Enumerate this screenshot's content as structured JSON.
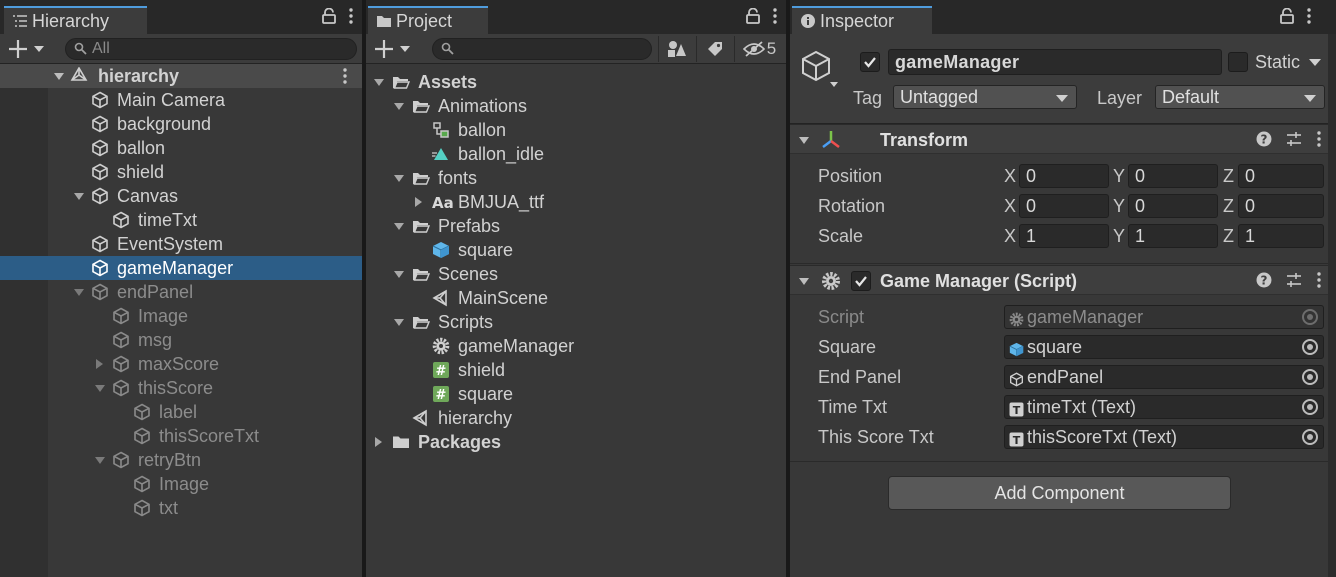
{
  "hierarchy": {
    "tab_title": "Hierarchy",
    "search_placeholder": "All",
    "scene_name": "hierarchy",
    "items": [
      {
        "label": "Main Camera",
        "depth": 1,
        "icon": "gameobject-cube-icon",
        "state": "normal",
        "arrow": "none"
      },
      {
        "label": "background",
        "depth": 1,
        "icon": "gameobject-cube-icon",
        "state": "normal",
        "arrow": "none"
      },
      {
        "label": "ballon",
        "depth": 1,
        "icon": "gameobject-cube-icon",
        "state": "normal",
        "arrow": "none"
      },
      {
        "label": "shield",
        "depth": 1,
        "icon": "gameobject-cube-icon",
        "state": "normal",
        "arrow": "none"
      },
      {
        "label": "Canvas",
        "depth": 1,
        "icon": "gameobject-cube-icon",
        "state": "normal",
        "arrow": "expanded"
      },
      {
        "label": "timeTxt",
        "depth": 2,
        "icon": "gameobject-cube-icon",
        "state": "normal",
        "arrow": "none"
      },
      {
        "label": "EventSystem",
        "depth": 1,
        "icon": "gameobject-cube-icon",
        "state": "normal",
        "arrow": "none"
      },
      {
        "label": "gameManager",
        "depth": 1,
        "icon": "gameobject-cube-icon",
        "state": "selected",
        "arrow": "none"
      },
      {
        "label": "endPanel",
        "depth": 1,
        "icon": "gameobject-cube-icon",
        "state": "disabled",
        "arrow": "expanded"
      },
      {
        "label": "Image",
        "depth": 2,
        "icon": "gameobject-cube-icon",
        "state": "disabled",
        "arrow": "none"
      },
      {
        "label": "msg",
        "depth": 2,
        "icon": "gameobject-cube-icon",
        "state": "disabled",
        "arrow": "none"
      },
      {
        "label": "maxScore",
        "depth": 2,
        "icon": "gameobject-cube-icon",
        "state": "disabled",
        "arrow": "collapsed"
      },
      {
        "label": "thisScore",
        "depth": 2,
        "icon": "gameobject-cube-icon",
        "state": "disabled",
        "arrow": "expanded"
      },
      {
        "label": "label",
        "depth": 3,
        "icon": "gameobject-cube-icon",
        "state": "disabled",
        "arrow": "none"
      },
      {
        "label": "thisScoreTxt",
        "depth": 3,
        "icon": "gameobject-cube-icon",
        "state": "disabled",
        "arrow": "none"
      },
      {
        "label": "retryBtn",
        "depth": 2,
        "icon": "gameobject-cube-icon",
        "state": "disabled",
        "arrow": "expanded"
      },
      {
        "label": "Image",
        "depth": 3,
        "icon": "gameobject-cube-icon",
        "state": "disabled",
        "arrow": "none"
      },
      {
        "label": "txt",
        "depth": 3,
        "icon": "gameobject-cube-icon",
        "state": "disabled",
        "arrow": "none"
      }
    ]
  },
  "project": {
    "tab_title": "Project",
    "search_value": "",
    "hidden_count": "5",
    "items": [
      {
        "label": "Assets",
        "depth": 0,
        "icon": "folder-open-icon",
        "arrow": "expanded",
        "bold": true
      },
      {
        "label": "Animations",
        "depth": 1,
        "icon": "folder-open-icon",
        "arrow": "expanded",
        "bold": false
      },
      {
        "label": "ballon",
        "depth": 2,
        "icon": "animator-controller-icon",
        "arrow": "none",
        "bold": false
      },
      {
        "label": "ballon_idle",
        "depth": 2,
        "icon": "animation-clip-icon",
        "arrow": "none",
        "bold": false
      },
      {
        "label": "fonts",
        "depth": 1,
        "icon": "folder-open-icon",
        "arrow": "expanded",
        "bold": false
      },
      {
        "label": "BMJUA_ttf",
        "depth": 2,
        "icon": "font-icon",
        "arrow": "collapsed",
        "bold": false
      },
      {
        "label": "Prefabs",
        "depth": 1,
        "icon": "folder-open-icon",
        "arrow": "expanded",
        "bold": false
      },
      {
        "label": "square",
        "depth": 2,
        "icon": "prefab-icon",
        "arrow": "none",
        "bold": false
      },
      {
        "label": "Scenes",
        "depth": 1,
        "icon": "folder-open-icon",
        "arrow": "expanded",
        "bold": false
      },
      {
        "label": "MainScene",
        "depth": 2,
        "icon": "unity-scene-icon",
        "arrow": "none",
        "bold": false
      },
      {
        "label": "Scripts",
        "depth": 1,
        "icon": "folder-open-icon",
        "arrow": "expanded",
        "bold": false
      },
      {
        "label": "gameManager",
        "depth": 2,
        "icon": "script-gear-icon",
        "arrow": "none",
        "bold": false
      },
      {
        "label": "shield",
        "depth": 2,
        "icon": "csharp-script-icon",
        "arrow": "none",
        "bold": false
      },
      {
        "label": "square",
        "depth": 2,
        "icon": "csharp-script-icon",
        "arrow": "none",
        "bold": false
      },
      {
        "label": "hierarchy",
        "depth": 1,
        "icon": "unity-scene-icon",
        "arrow": "none",
        "bold": false
      },
      {
        "label": "Packages",
        "depth": 0,
        "icon": "folder-closed-icon",
        "arrow": "collapsed",
        "bold": true
      }
    ]
  },
  "inspector": {
    "tab_title": "Inspector",
    "object_name": "gameManager",
    "active": true,
    "static_label": "Static",
    "tag_label": "Tag",
    "tag_value": "Untagged",
    "layer_label": "Layer",
    "layer_value": "Default",
    "transform": {
      "title": "Transform",
      "rows": [
        {
          "label": "Position",
          "x": "0",
          "y": "0",
          "z": "0"
        },
        {
          "label": "Rotation",
          "x": "0",
          "y": "0",
          "z": "0"
        },
        {
          "label": "Scale",
          "x": "1",
          "y": "1",
          "z": "1"
        }
      ],
      "axis_x": "X",
      "axis_y": "Y",
      "axis_z": "Z"
    },
    "script_component": {
      "title": "Game Manager (Script)",
      "enabled": true,
      "fields": [
        {
          "label": "Script",
          "value": "gameManager",
          "icon": "script-gear-icon",
          "disabled": true
        },
        {
          "label": "Square",
          "value": "square",
          "icon": "prefab-icon",
          "disabled": false
        },
        {
          "label": "End Panel",
          "value": "endPanel",
          "icon": "gameobject-cube-icon",
          "disabled": false
        },
        {
          "label": "Time Txt",
          "value": "timeTxt (Text)",
          "icon": "text-component-icon",
          "disabled": false
        },
        {
          "label": "This Score Txt",
          "value": "thisScoreTxt (Text)",
          "icon": "text-component-icon",
          "disabled": false
        }
      ]
    },
    "add_component_label": "Add Component"
  }
}
